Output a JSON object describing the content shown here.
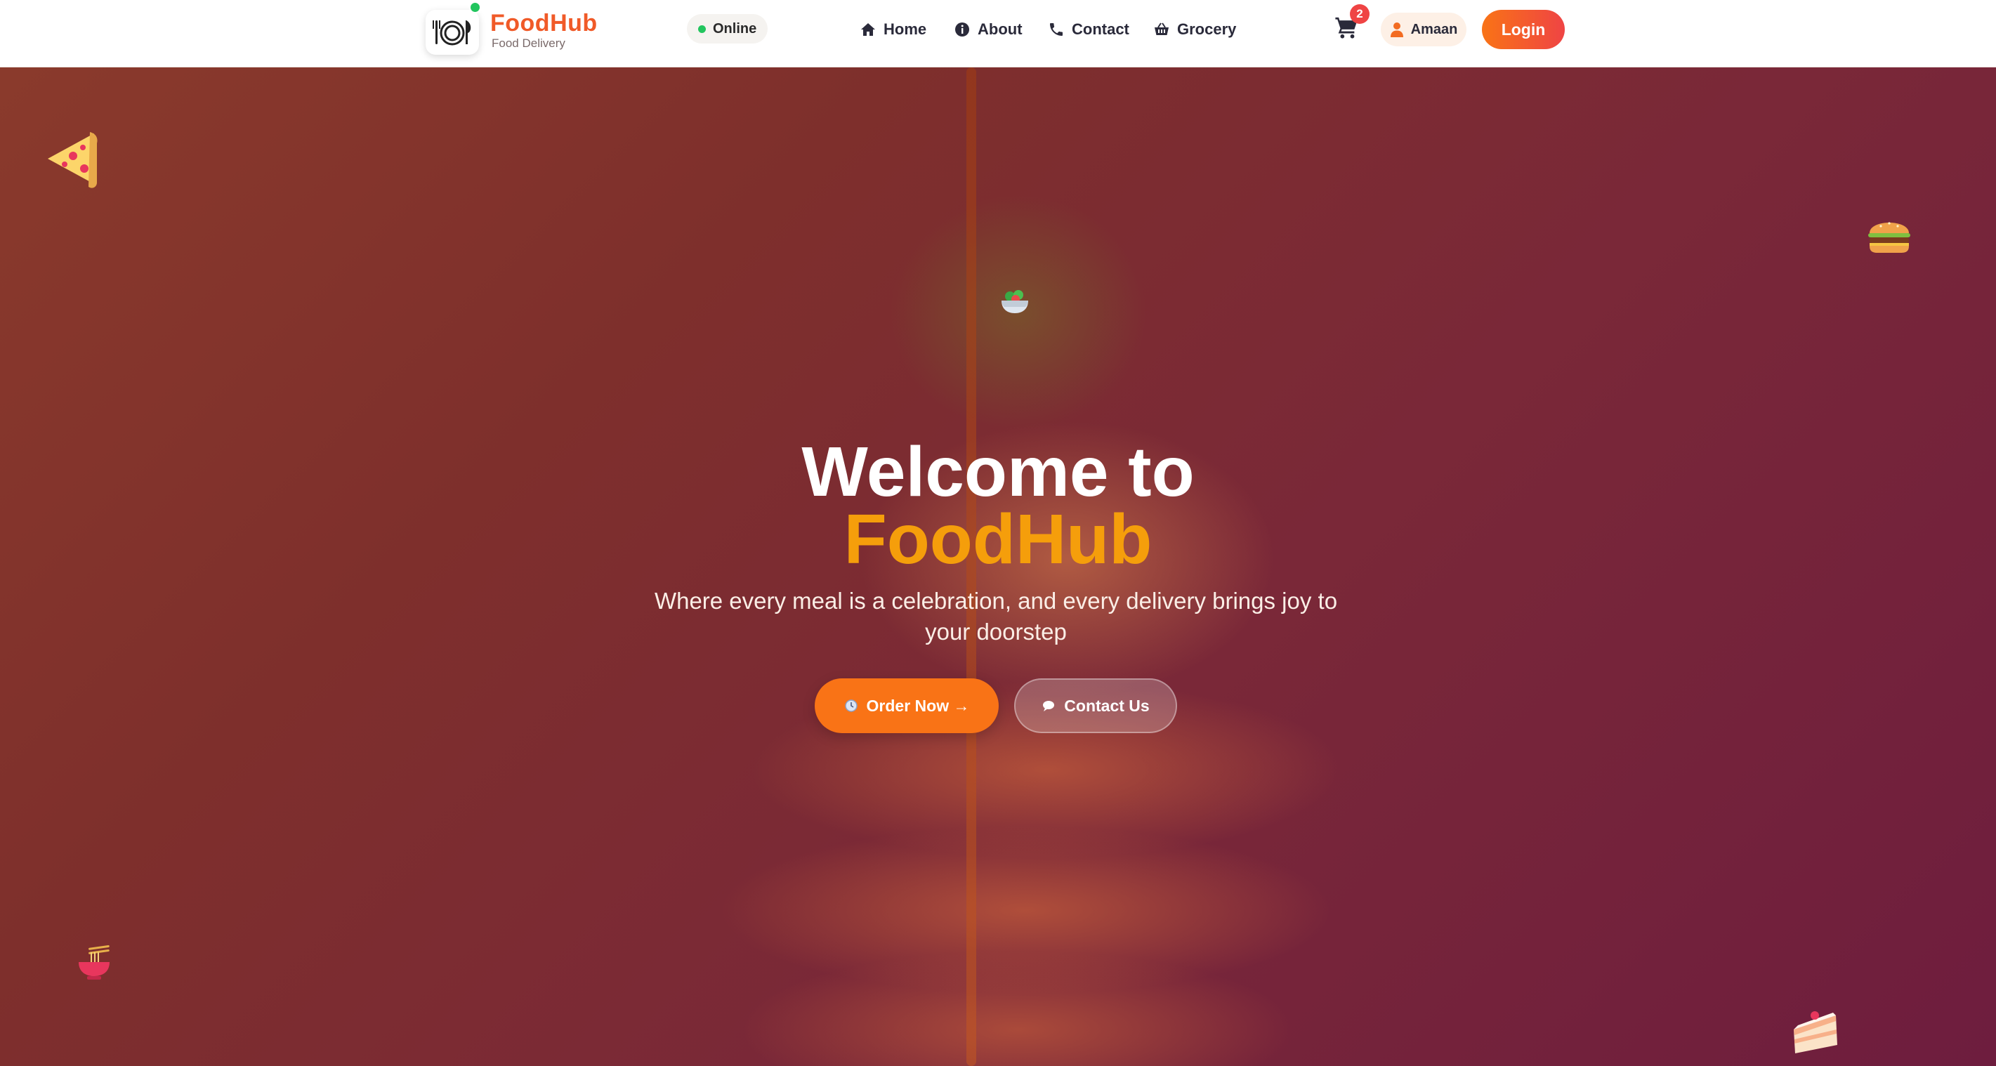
{
  "brand": {
    "name": "FoodHub",
    "tagline": "Food Delivery"
  },
  "status": {
    "label": "Online",
    "color": "#22c55e"
  },
  "nav": [
    {
      "label": "Home",
      "icon": "home-icon"
    },
    {
      "label": "About",
      "icon": "info-icon"
    },
    {
      "label": "Contact",
      "icon": "phone-icon"
    },
    {
      "label": "Grocery",
      "icon": "basket-icon"
    }
  ],
  "cart": {
    "count": "2",
    "icon": "cart-icon"
  },
  "user": {
    "name": "Amaan",
    "icon": "user-icon"
  },
  "login": {
    "label": "Login"
  },
  "hero": {
    "title_line1": "Welcome to",
    "title_line2": "FoodHub",
    "subtitle": "Where every meal is a celebration, and every delivery brings joy to your doorstep",
    "order_button": "Order Now →",
    "contact_button": "Contact Us"
  },
  "floating_icons": [
    "pizza-icon",
    "burger-icon",
    "salad-icon",
    "noodles-icon",
    "cake-icon"
  ],
  "colors": {
    "accent": "#f97316",
    "brand": "#f05a28",
    "title_highlight": "#f59e0b",
    "badge": "#ef4444"
  }
}
